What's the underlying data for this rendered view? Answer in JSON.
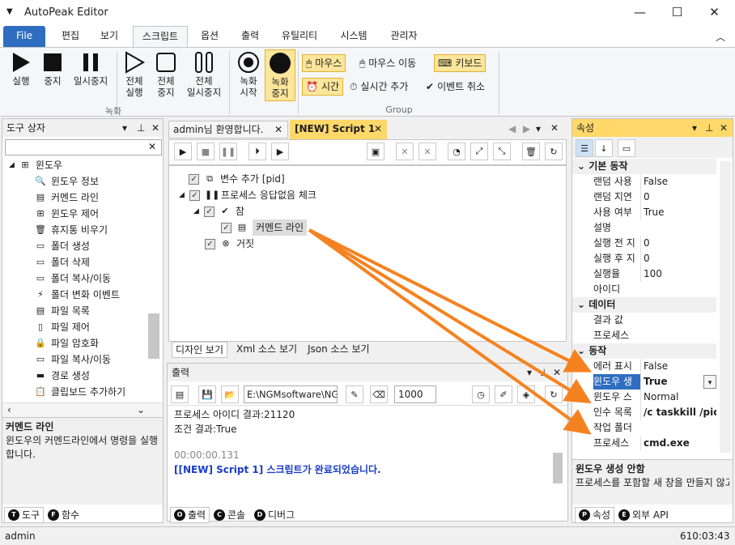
{
  "app": {
    "title": "AutoPeak Editor",
    "status_user": "admin",
    "status_time": "610:03:43"
  },
  "window_controls": {
    "minimize": "—",
    "maximize": "☐",
    "close": "✕"
  },
  "menu": {
    "file": "File",
    "tabs": [
      "편집",
      "보기",
      "스크립트",
      "옵션",
      "출력",
      "유틸리티",
      "시스템",
      "관리자"
    ]
  },
  "ribbon": {
    "rec_group": "녹화",
    "group_label": "Group",
    "buttons": {
      "run": "실행",
      "stop": "중지",
      "pause": "일시중지",
      "run_all_1": "전체",
      "run_all_2": "실행",
      "stop_all_1": "전체",
      "stop_all_2": "중지",
      "pause_all_1": "전체",
      "pause_all_2": "일시중지",
      "rec_start_1": "녹화",
      "rec_start_2": "시작",
      "rec_stop_1": "녹화",
      "rec_stop_2": "중지"
    },
    "small": {
      "mouse": "마우스",
      "mouse_move": "마우스 이동",
      "keyboard": "키보드",
      "time": "시간",
      "realtime_add": "실시간 추가",
      "event_cancel": "이벤트 취소"
    }
  },
  "toolbox": {
    "title": "도구 상자",
    "root": "윈도우",
    "items": [
      "윈도우 정보",
      "커멘드 라인",
      "윈도우 제어",
      "휴지통 비우기",
      "폴더 생성",
      "폴더 삭제",
      "폴더 복사/이동",
      "폴더 변화 이벤트",
      "파일 목록",
      "파일 제어",
      "파일 암호화",
      "파일 복사/이동",
      "경로 생성",
      "클립보드 추가하기"
    ],
    "desc_title": "커멘드 라인",
    "desc_text": "윈도우의 커멘드라인에서 명령을 실행합니다.",
    "tabs": {
      "tools": "도구",
      "funcs": "함수"
    }
  },
  "editor": {
    "tab1": "admin님 환영합니다.",
    "tab2": "[NEW] Script 1",
    "nodes": {
      "var_add": "변수 추가 [pid]",
      "proc_check": "프로세스 응답없음 체크",
      "true_node": "참",
      "cmd": "커멘드 라인",
      "false_node": "거짓"
    },
    "view_tabs": [
      "디자인 보기",
      "Xml 소스 보기",
      "Json 소스 보기"
    ]
  },
  "output": {
    "title": "출력",
    "path": "E:\\NGMsoftware\\NG",
    "count": "1000",
    "lines": {
      "l1": "프로세스 아이디 결과:21120",
      "l2": "조건 결과:True",
      "l3": "00:00:00.131",
      "l4": "[[NEW] Script 1] 스크립트가 완료되었습니다."
    },
    "tabs": {
      "output": "출력",
      "console": "콘솔",
      "debugger": "디버그"
    }
  },
  "properties": {
    "title": "속성",
    "cat_basic": "기본 동작",
    "basic": [
      {
        "k": "랜덤 사용",
        "v": "False"
      },
      {
        "k": "랜덤 지연",
        "v": "0"
      },
      {
        "k": "사용 여부",
        "v": "True"
      },
      {
        "k": "설명",
        "v": ""
      },
      {
        "k": "실행 전 지",
        "v": "0"
      },
      {
        "k": "실행 후 지",
        "v": "0"
      },
      {
        "k": "실행율",
        "v": "100"
      },
      {
        "k": "아이디",
        "v": ""
      }
    ],
    "cat_data": "데이터",
    "data": [
      {
        "k": "결과 값",
        "v": ""
      },
      {
        "k": "프로세스 ",
        "v": ""
      }
    ],
    "cat_action": "동작",
    "action": [
      {
        "k": "에러 표시",
        "v": "False"
      },
      {
        "k": "윈도우 생",
        "v": "True"
      },
      {
        "k": "윈도우 스",
        "v": "Normal"
      },
      {
        "k": "인수 목록",
        "v": "/c taskkill /pid {p"
      },
      {
        "k": "작업 폴더",
        "v": ""
      },
      {
        "k": "프로세스 ",
        "v": "cmd.exe"
      }
    ],
    "desc_title": "윈도우 생성 안함",
    "desc_text": "프로세스를 포함할 새 창을 만들지 않고 프로세스를 시작해야 하면 t...",
    "tabs": {
      "props": "속성",
      "external": "외부 API"
    }
  },
  "colors": {
    "accent": "#2f6dc0",
    "highlight": "#ffd86a",
    "arrow": "#f58220"
  }
}
